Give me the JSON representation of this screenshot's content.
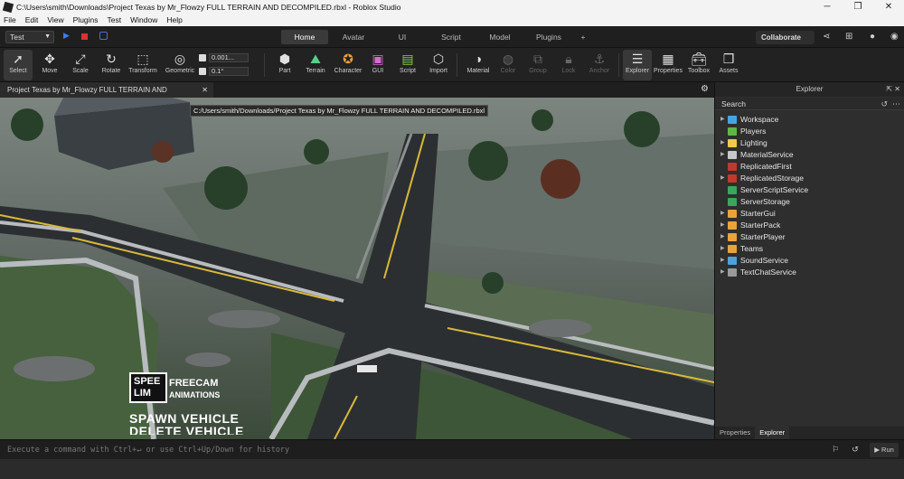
{
  "window": {
    "title": "C:\\Users\\smith\\Downloads\\Project Texas by Mr_Flowzy FULL TERRAIN AND DECOMPILED.rbxl - Roblox Studio"
  },
  "menu": [
    "File",
    "Edit",
    "View",
    "Plugins",
    "Test",
    "Window",
    "Help"
  ],
  "toolbar": {
    "mode": "Test",
    "tabs": [
      "Home",
      "Avatar",
      "UI",
      "Script",
      "Model",
      "Plugins",
      "+"
    ],
    "active_tab": "Home",
    "collaborate": "Collaborate"
  },
  "ribbon": {
    "tools": [
      "Select",
      "Move",
      "Scale",
      "Rotate",
      "Transform",
      "Geometric"
    ],
    "snap_move": "0.001...",
    "snap_rotate": "0.1°",
    "insert": [
      "Part",
      "Terrain",
      "Character",
      "GUI",
      "Script",
      "Import"
    ],
    "edit": [
      "Material",
      "Color",
      "Group",
      "Lock",
      "Anchor"
    ],
    "panels": [
      "Explorer",
      "Properties",
      "Toolbox",
      "Assets"
    ]
  },
  "doc": {
    "tab": "Project Texas by Mr_Flowzy FULL TERRAIN AND DECOMPILED.rbxl",
    "tooltip": "C:/Users/smith/Downloads/Project Texas by Mr_Flowzy FULL TERRAIN AND DECOMPILED.rbxl"
  },
  "hud": {
    "badge": "SPEE\nLIM",
    "freecam": "FREECAM",
    "animations": "ANIMATIONS",
    "spawn": "SPAWN VEHICLE",
    "delete": "DELETE VEHICLE"
  },
  "explorer": {
    "title": "Explorer",
    "search": "Search",
    "items": [
      {
        "label": "Workspace",
        "expand": true,
        "color": "#4aa3df"
      },
      {
        "label": "Players",
        "expand": false,
        "color": "#5fb845"
      },
      {
        "label": "Lighting",
        "expand": true,
        "color": "#f2c94c"
      },
      {
        "label": "MaterialService",
        "expand": true,
        "color": "#c8c8c8"
      },
      {
        "label": "ReplicatedFirst",
        "expand": false,
        "color": "#c0392b"
      },
      {
        "label": "ReplicatedStorage",
        "expand": true,
        "color": "#c0392b"
      },
      {
        "label": "ServerScriptService",
        "expand": false,
        "color": "#3ba55c"
      },
      {
        "label": "ServerStorage",
        "expand": false,
        "color": "#3ba55c"
      },
      {
        "label": "StarterGui",
        "expand": true,
        "color": "#e8a33d"
      },
      {
        "label": "StarterPack",
        "expand": true,
        "color": "#e8a33d"
      },
      {
        "label": "StarterPlayer",
        "expand": true,
        "color": "#e8a33d"
      },
      {
        "label": "Teams",
        "expand": true,
        "color": "#e8a33d"
      },
      {
        "label": "SoundService",
        "expand": true,
        "color": "#4aa3df"
      },
      {
        "label": "TextChatService",
        "expand": true,
        "color": "#9a9a9a"
      }
    ],
    "tabs": [
      "Properties",
      "Explorer"
    ]
  },
  "command": {
    "placeholder": "Execute a command with Ctrl+↵ or use Ctrl+Up/Down for history",
    "run": "Run"
  }
}
